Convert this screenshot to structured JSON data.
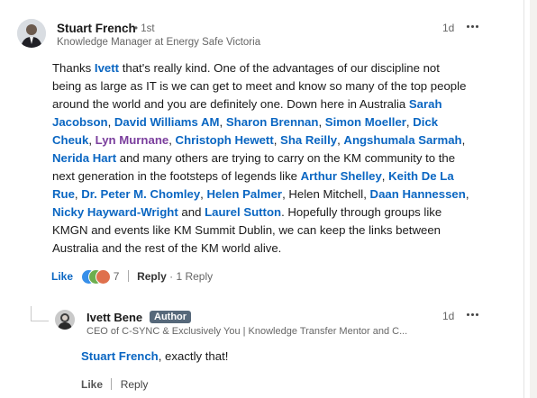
{
  "comment": {
    "author_name": "Stuart French",
    "degree": "• 1st",
    "headline": "Knowledge Manager at Energy Safe Victoria",
    "time": "1d",
    "body": [
      {
        "t": "Thanks "
      },
      {
        "m": "Ivett"
      },
      {
        "t": " that's really kind. One of the advantages of our discipline not being as large as IT is we can get to meet and know so many of the top people around the world and you are definitely one. Down here in Australia "
      },
      {
        "m": "Sarah Jacobson"
      },
      {
        "t": ", "
      },
      {
        "m": "David Williams AM"
      },
      {
        "t": ", "
      },
      {
        "m": "Sharon Brennan"
      },
      {
        "t": ", "
      },
      {
        "m": "Simon Moeller"
      },
      {
        "t": ", "
      },
      {
        "m": "Dick Cheuk"
      },
      {
        "t": ", "
      },
      {
        "m": "Lyn Murnane",
        "visited": true
      },
      {
        "t": ", "
      },
      {
        "m": "Christoph Hewett"
      },
      {
        "t": ", "
      },
      {
        "m": "Sha Reilly"
      },
      {
        "t": ", "
      },
      {
        "m": "Angshumala Sarmah"
      },
      {
        "t": ", "
      },
      {
        "m": "Nerida Hart"
      },
      {
        "t": " and many others are trying to carry on the KM community to the next generation in the footsteps of legends like "
      },
      {
        "m": "Arthur Shelley"
      },
      {
        "t": ", "
      },
      {
        "m": "Keith De La Rue"
      },
      {
        "t": ", "
      },
      {
        "m": "Dr. Peter M. Chomley"
      },
      {
        "t": ", "
      },
      {
        "m": "Helen Palmer"
      },
      {
        "t": ", Helen Mitchell, "
      },
      {
        "m": "Daan Hannessen"
      },
      {
        "t": ", "
      },
      {
        "m": "Nicky Hayward-Wright"
      },
      {
        "t": " and "
      },
      {
        "m": "Laurel Sutton"
      },
      {
        "t": ". Hopefully through groups like KMGN and events like KM Summit Dublin, we can keep the links between Australia and the rest of the KM world alive."
      }
    ],
    "like_label": "Like",
    "reaction_count": "7",
    "reply_label": "Reply",
    "reply_count": "1 Reply",
    "reaction_icons": [
      "like-icon",
      "celebrate-icon",
      "heart-icon"
    ]
  },
  "reply": {
    "author_name": "Ivett Bene",
    "badge": "Author",
    "headline": "CEO of C-SYNC & Exclusively You | Knowledge Transfer Mentor and C...",
    "time": "1d",
    "mention": "Stuart French",
    "text": ", exactly that!",
    "like_label": "Like",
    "reply_label": "Reply"
  },
  "colors": {
    "mention": "#0a66c2",
    "mention_visited": "#7a3e9d",
    "author_badge": "#56687a"
  }
}
